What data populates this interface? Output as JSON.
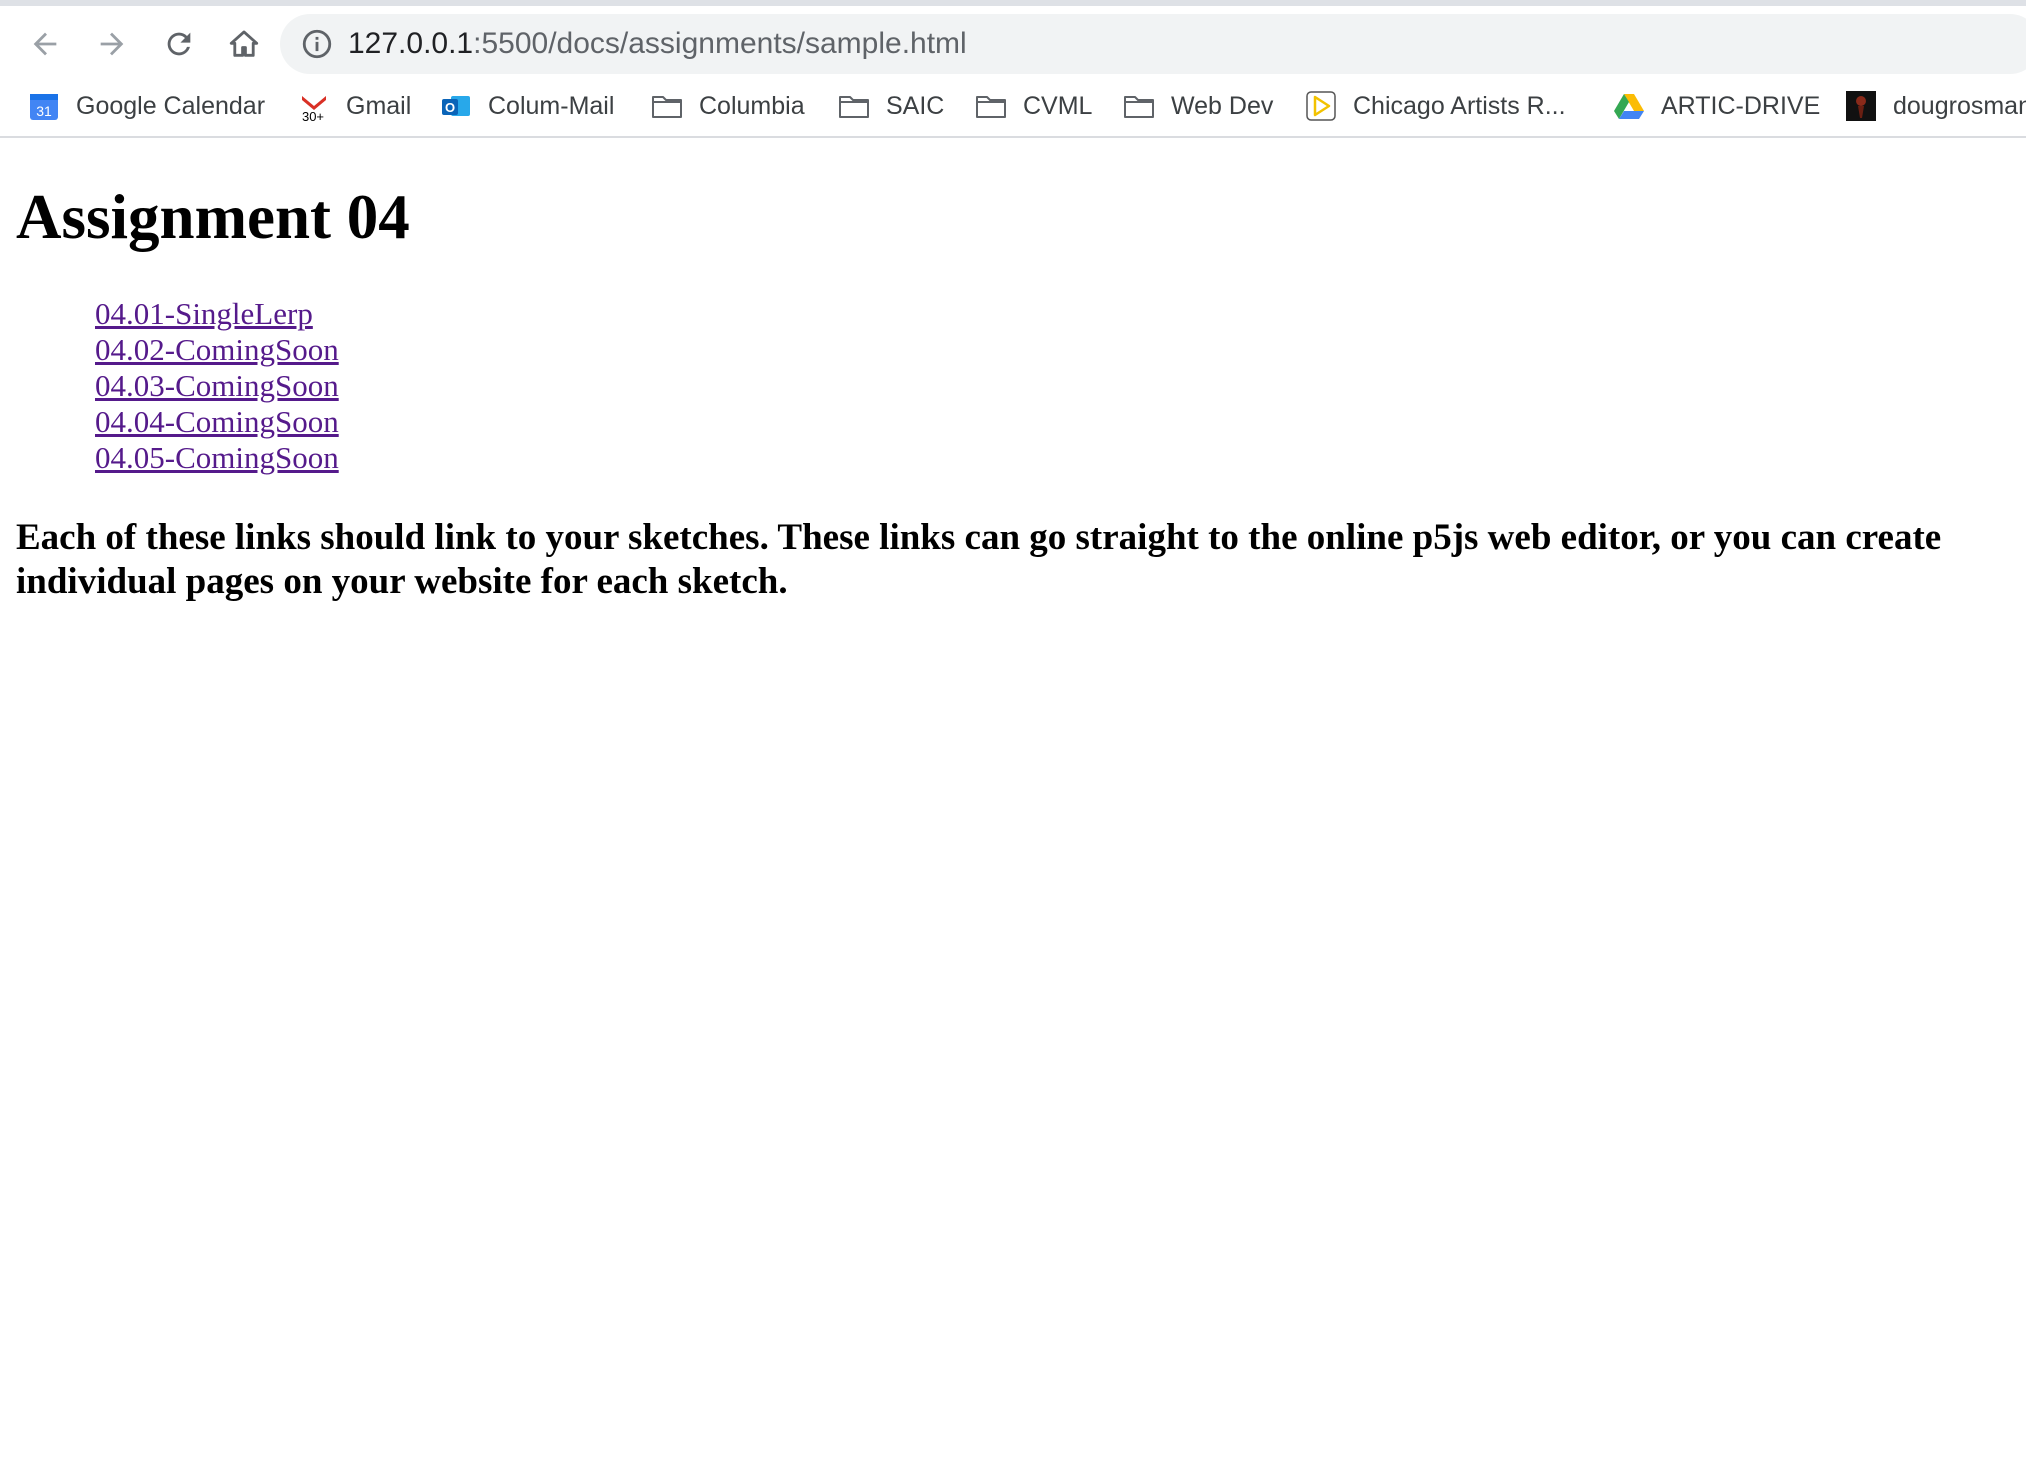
{
  "browser": {
    "url_host": "127.0.0.1",
    "url_path": ":5500/docs/assignments/sample.html",
    "bookmarks": [
      {
        "label": "Google Calendar",
        "icon": "calendar-icon",
        "icon_text": "31"
      },
      {
        "label": "Gmail",
        "icon": "gmail-icon",
        "icon_text": "30+"
      },
      {
        "label": "Colum-Mail",
        "icon": "outlook-icon",
        "icon_text": "O"
      },
      {
        "label": "Columbia",
        "icon": "folder-icon"
      },
      {
        "label": "SAIC",
        "icon": "folder-icon"
      },
      {
        "label": "CVML",
        "icon": "folder-icon"
      },
      {
        "label": "Web Dev",
        "icon": "folder-icon"
      },
      {
        "label": "Chicago Artists R...",
        "icon": "play-icon"
      },
      {
        "label": "ARTIC-DRIVE",
        "icon": "drive-icon"
      },
      {
        "label": "dougrosman",
        "icon": "avatar-icon"
      }
    ]
  },
  "page": {
    "title": "Assignment 04",
    "links": [
      "04.01-SingleLerp",
      "04.02-ComingSoon",
      "04.03-ComingSoon",
      "04.04-ComingSoon",
      "04.05-ComingSoon"
    ],
    "note": "Each of these links should link to your sketches. These links can go straight to the online p5js web editor, or you can create individual pages on your website for each sketch."
  },
  "colors": {
    "visited_link": "#551a8b",
    "omnibox_bg": "#f1f3f4",
    "gmail_red": "#d93025",
    "calendar_blue": "#4285f4",
    "outlook_blue": "#0a64b8",
    "play_yellow": "#f2c200"
  }
}
